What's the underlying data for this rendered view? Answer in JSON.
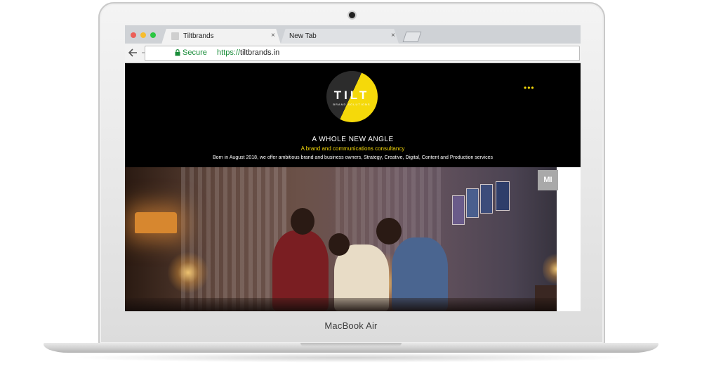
{
  "device": {
    "label": "MacBook Air"
  },
  "browser": {
    "tabs": [
      {
        "title": "Tiltbrands",
        "active": true
      },
      {
        "title": "New Tab",
        "active": false
      }
    ],
    "close_glyph": "×",
    "security_label": "Secure",
    "url_scheme": "https://",
    "url_host": "tiltbrands.in",
    "icons": {
      "back": "arrow-left-icon",
      "forward": "arrow-right-icon",
      "reload": "reload-icon",
      "lock": "lock-icon",
      "new_tab": "new-tab-icon"
    },
    "traffic_light_colors": [
      "#ec5f58",
      "#f7bd2e",
      "#2bc642"
    ]
  },
  "site": {
    "logo_text": "TILT",
    "logo_subtext": "BRAND SOLUTIONS",
    "menu_glyph": "•••",
    "headline": "A WHOLE NEW ANGLE",
    "tagline": "A brand and communications consultancy",
    "description": "Born in August 2018, we offer ambitious brand and business owners, Strategy, Creative, Digital, Content and Production services",
    "hero_badge": "MI",
    "accent_color": "#f5d90a",
    "background_color": "#000000"
  }
}
